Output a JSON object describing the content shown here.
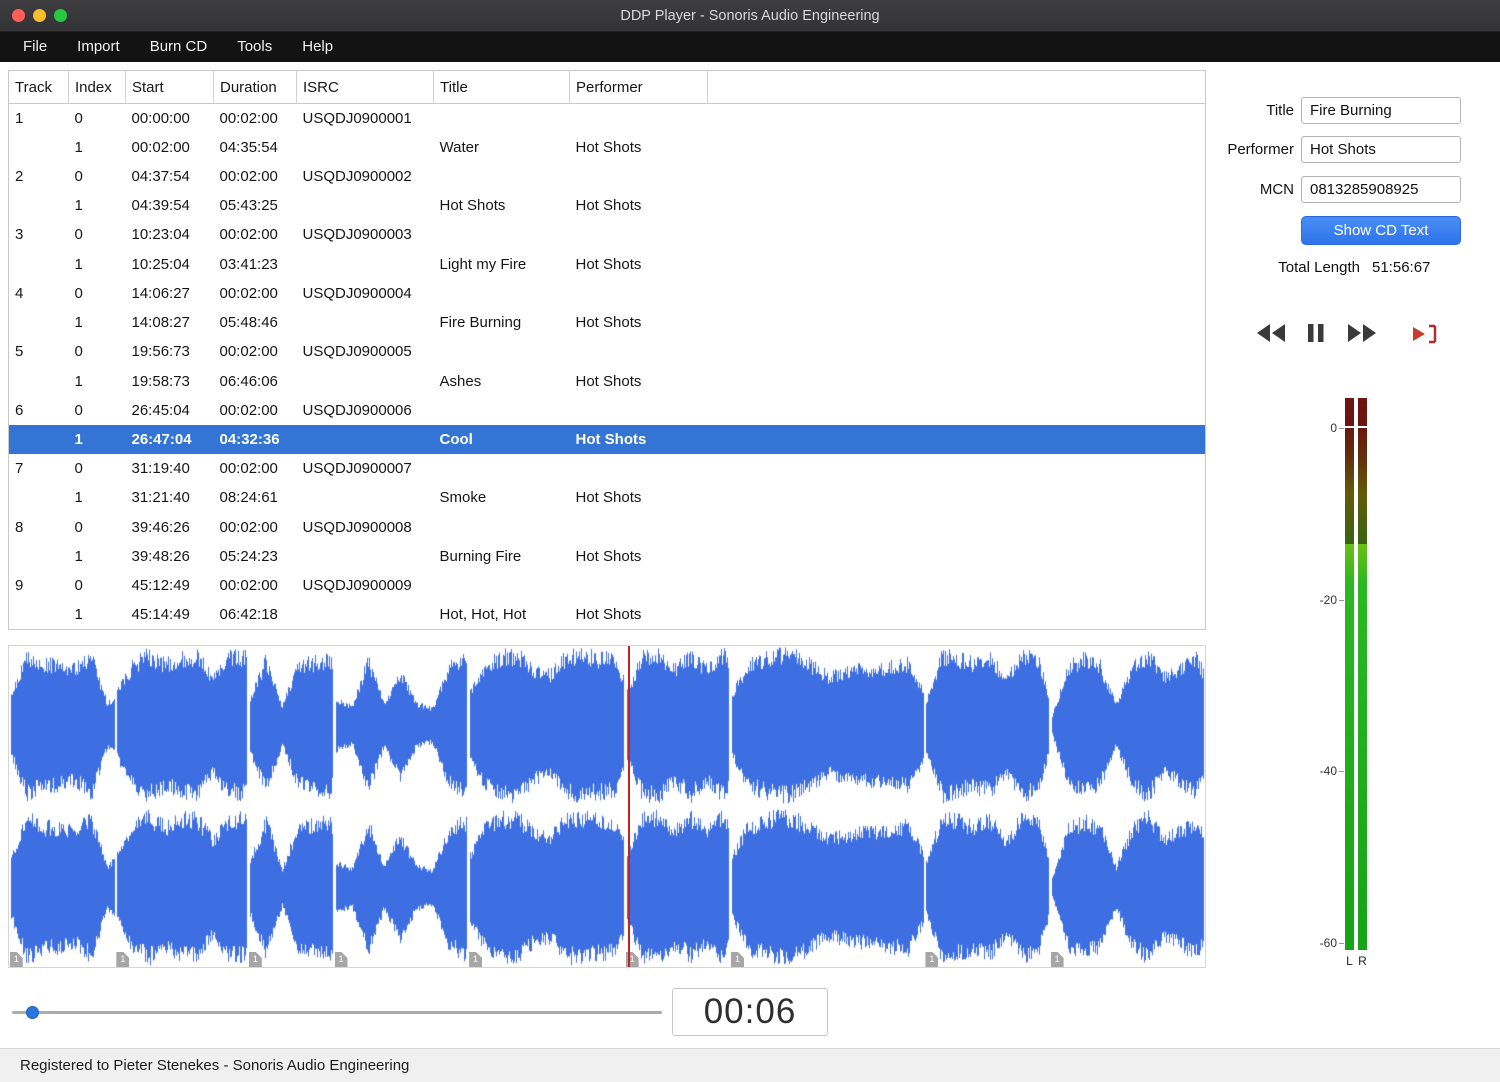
{
  "window": {
    "title": "DDP Player - Sonoris Audio Engineering"
  },
  "menu": {
    "items": [
      "File",
      "Import",
      "Burn CD",
      "Tools",
      "Help"
    ]
  },
  "track_list": {
    "columns": [
      "Track",
      "Index",
      "Start",
      "Duration",
      "ISRC",
      "Title",
      "Performer"
    ],
    "rows": [
      {
        "track": "1",
        "index": "0",
        "start": "00:00:00",
        "duration": "00:02:00",
        "isrc": "USQDJ0900001",
        "title": "",
        "performer": "",
        "selected": false
      },
      {
        "track": "",
        "index": "1",
        "start": "00:02:00",
        "duration": "04:35:54",
        "isrc": "",
        "title": "Water",
        "performer": "Hot Shots",
        "selected": false
      },
      {
        "track": "2",
        "index": "0",
        "start": "04:37:54",
        "duration": "00:02:00",
        "isrc": "USQDJ0900002",
        "title": "",
        "performer": "",
        "selected": false
      },
      {
        "track": "",
        "index": "1",
        "start": "04:39:54",
        "duration": "05:43:25",
        "isrc": "",
        "title": "Hot Shots",
        "performer": "Hot Shots",
        "selected": false
      },
      {
        "track": "3",
        "index": "0",
        "start": "10:23:04",
        "duration": "00:02:00",
        "isrc": "USQDJ0900003",
        "title": "",
        "performer": "",
        "selected": false
      },
      {
        "track": "",
        "index": "1",
        "start": "10:25:04",
        "duration": "03:41:23",
        "isrc": "",
        "title": "Light my Fire",
        "performer": "Hot Shots",
        "selected": false
      },
      {
        "track": "4",
        "index": "0",
        "start": "14:06:27",
        "duration": "00:02:00",
        "isrc": "USQDJ0900004",
        "title": "",
        "performer": "",
        "selected": false
      },
      {
        "track": "",
        "index": "1",
        "start": "14:08:27",
        "duration": "05:48:46",
        "isrc": "",
        "title": "Fire Burning",
        "performer": "Hot Shots",
        "selected": false
      },
      {
        "track": "5",
        "index": "0",
        "start": "19:56:73",
        "duration": "00:02:00",
        "isrc": "USQDJ0900005",
        "title": "",
        "performer": "",
        "selected": false
      },
      {
        "track": "",
        "index": "1",
        "start": "19:58:73",
        "duration": "06:46:06",
        "isrc": "",
        "title": "Ashes",
        "performer": "Hot Shots",
        "selected": false
      },
      {
        "track": "6",
        "index": "0",
        "start": "26:45:04",
        "duration": "00:02:00",
        "isrc": "USQDJ0900006",
        "title": "",
        "performer": "",
        "selected": false
      },
      {
        "track": "",
        "index": "1",
        "start": "26:47:04",
        "duration": "04:32:36",
        "isrc": "",
        "title": "Cool",
        "performer": "Hot Shots",
        "selected": true
      },
      {
        "track": "7",
        "index": "0",
        "start": "31:19:40",
        "duration": "00:02:00",
        "isrc": "USQDJ0900007",
        "title": "",
        "performer": "",
        "selected": false
      },
      {
        "track": "",
        "index": "1",
        "start": "31:21:40",
        "duration": "08:24:61",
        "isrc": "",
        "title": "Smoke",
        "performer": "Hot Shots",
        "selected": false
      },
      {
        "track": "8",
        "index": "0",
        "start": "39:46:26",
        "duration": "00:02:00",
        "isrc": "USQDJ0900008",
        "title": "",
        "performer": "",
        "selected": false
      },
      {
        "track": "",
        "index": "1",
        "start": "39:48:26",
        "duration": "05:24:23",
        "isrc": "",
        "title": "Burning Fire",
        "performer": "Hot Shots",
        "selected": false
      },
      {
        "track": "9",
        "index": "0",
        "start": "45:12:49",
        "duration": "00:02:00",
        "isrc": "USQDJ0900009",
        "title": "",
        "performer": "",
        "selected": false
      },
      {
        "track": "",
        "index": "1",
        "start": "45:14:49",
        "duration": "06:42:18",
        "isrc": "",
        "title": "Hot, Hot, Hot",
        "performer": "Hot Shots",
        "selected": false
      }
    ]
  },
  "cd_text": {
    "title_label": "Title",
    "title_value": "Fire Burning",
    "performer_label": "Performer",
    "performer_value": "Hot Shots",
    "mcn_label": "MCN",
    "mcn_value": "0813285908925",
    "show_cd_text_button": "Show CD Text",
    "total_length_label": "Total Length",
    "total_length_value": "51:56:67"
  },
  "meter": {
    "db_labels": [
      {
        "db": 0,
        "text": "0"
      },
      {
        "db": 20,
        "text": "-20"
      },
      {
        "db": 40,
        "text": "-40"
      },
      {
        "db": 60,
        "text": "-60"
      }
    ],
    "left_label": "L",
    "right_label": "R",
    "level_db": -13.5
  },
  "waveform": {
    "marker_label": "1",
    "color": "#3e6fe2"
  },
  "playback": {
    "elapsed": "00:06"
  },
  "status_bar": "Registered to Pieter Stenekes - Sonoris Audio Engineering",
  "colors": {
    "selection_blue": "#3374d4",
    "button_blue": "#3d7ff0",
    "waveform_blue": "#3e6fe2",
    "playhead_red": "#c52222"
  }
}
